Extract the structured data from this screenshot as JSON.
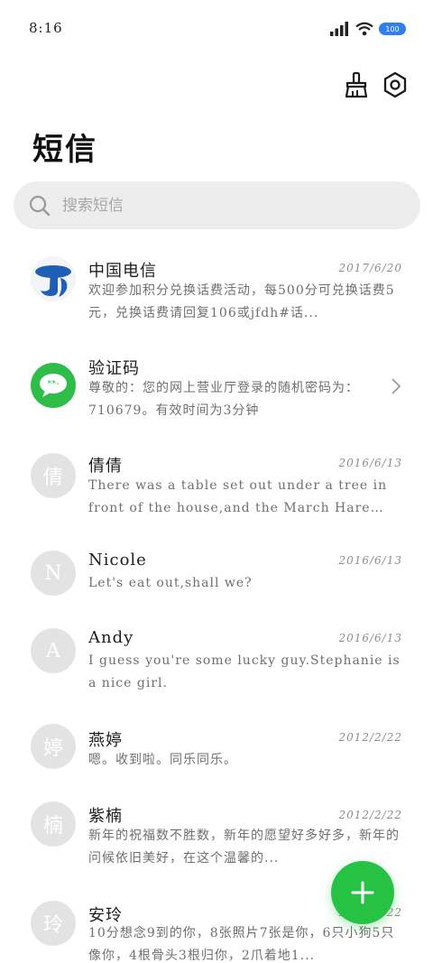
{
  "status_bar": {
    "time": "8:16",
    "battery": "100"
  },
  "header": {
    "title": "短信"
  },
  "search": {
    "placeholder": "搜索短信"
  },
  "messages": [
    {
      "sender": "中国电信",
      "date": "2017/6/20",
      "preview": "欢迎参加积分兑换话费活动，每500分可兑换话费5元，兑换话费请回复106或jfdh#话..."
    },
    {
      "sender": "验证码",
      "date": "",
      "preview": "尊敬的：您的网上营业厅登录的随机密码为：710679。有效时间为3分钟"
    },
    {
      "sender": "倩倩",
      "date": "2016/6/13",
      "avatar_letter": "倩",
      "preview": "There was a table set out under a tree in front of the house,and the March Hare an..."
    },
    {
      "sender": "Nicole",
      "date": "2016/6/13",
      "avatar_letter": "N",
      "preview": "Let's eat out,shall we?"
    },
    {
      "sender": "Andy",
      "date": "2016/6/13",
      "avatar_letter": "A",
      "preview": "I guess you're some lucky guy.Stephanie is a nice girl."
    },
    {
      "sender": "燕婷",
      "date": "2012/2/22",
      "avatar_letter": "婷",
      "preview": "嗯。收到啦。同乐同乐。"
    },
    {
      "sender": "紫楠",
      "date": "2012/2/22",
      "avatar_letter": "楠",
      "preview": "新年的祝福数不胜数，新年的愿望好多好多，新年的问候依旧美好，在这个温馨的..."
    },
    {
      "sender": "安玲",
      "date": "2012/2/22",
      "avatar_letter": "玲",
      "preview": "10分想念9到的你，8张照片7张是你，6只小狗5只像你，4根骨头3根归你，2爪着地1..."
    }
  ],
  "colors": {
    "accent": "#25c244",
    "search_bg": "#ededed",
    "avatar_bg": "#e3e3e3",
    "battery": "#2f7ff0"
  },
  "icons": {
    "clean": "broom-icon",
    "settings": "hexagon-gear-icon",
    "search": "magnifier-icon",
    "fab": "plus-icon"
  }
}
